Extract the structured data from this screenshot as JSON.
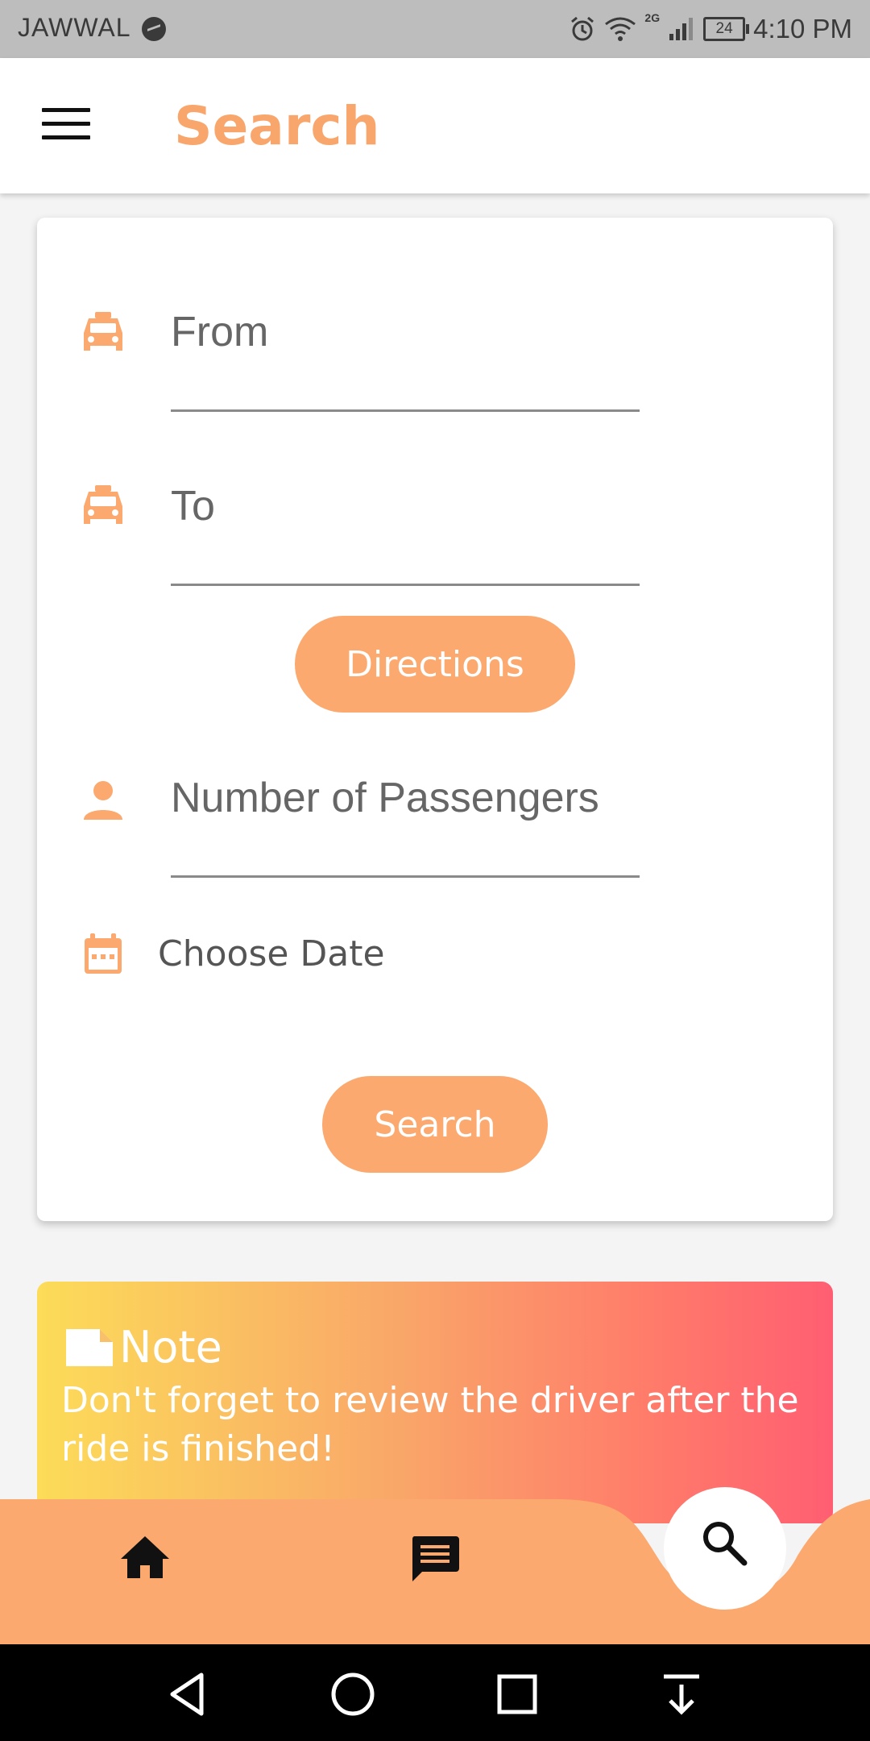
{
  "status_bar": {
    "carrier": "JAWWAL",
    "network": "2G",
    "battery": "24",
    "time": "4:10 PM"
  },
  "app_bar": {
    "title": "Search",
    "menu_icon": "hamburger-menu-icon"
  },
  "form": {
    "from": {
      "placeholder": "From",
      "icon": "taxi-icon"
    },
    "to": {
      "placeholder": "To",
      "icon": "taxi-icon"
    },
    "directions_label": "Directions",
    "passengers": {
      "placeholder": "Number of Passengers",
      "icon": "person-icon"
    },
    "date": {
      "label": "Choose Date",
      "icon": "calendar-icon"
    },
    "search_label": "Search"
  },
  "note": {
    "title": "Note",
    "body": "Don't forget to review the driver after the ride is finished!",
    "icon": "note-icon"
  },
  "bottom_nav": {
    "items": [
      {
        "name": "home",
        "icon": "home-icon"
      },
      {
        "name": "messages",
        "icon": "chat-icon"
      },
      {
        "name": "search",
        "icon": "search-icon",
        "active": true
      }
    ]
  },
  "colors": {
    "accent": "#fba96e",
    "title": "#f9a66c",
    "note_gradient": [
      "#fcdc58",
      "#f9a769",
      "#ff5e72"
    ]
  }
}
